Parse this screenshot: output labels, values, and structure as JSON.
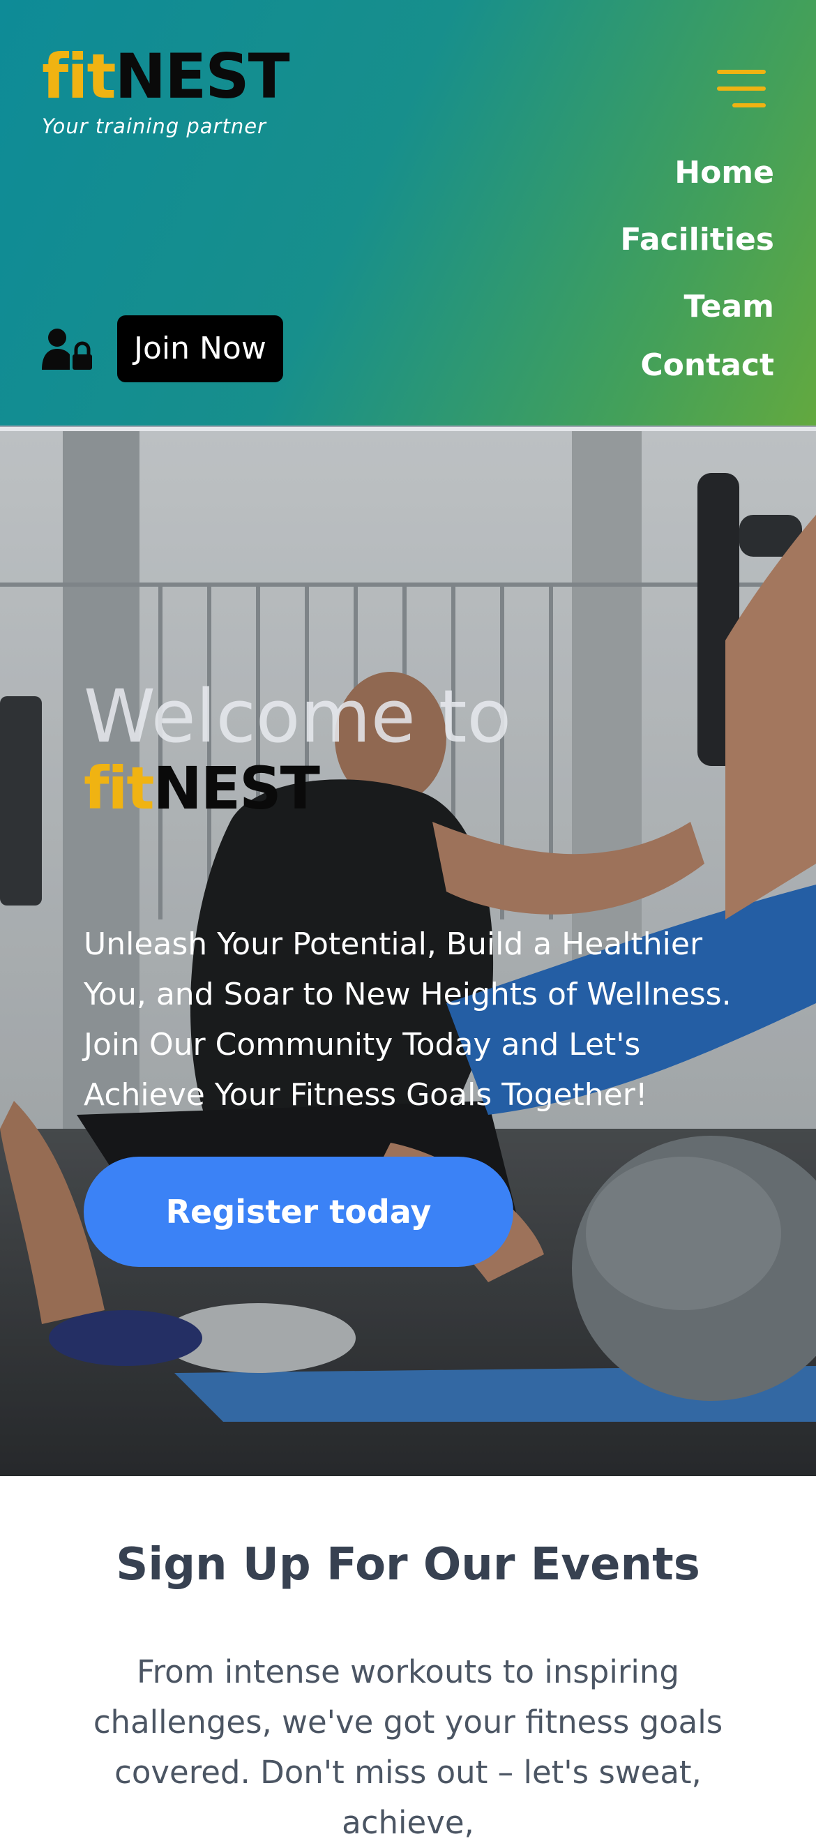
{
  "brand": {
    "fit": "fit",
    "nest": "NEST",
    "tagline": "Your training partner",
    "colors": {
      "fit": "#f0b312",
      "nest": "#0a0a0a",
      "header_start": "#0e8b97",
      "header_end": "#63a93f"
    }
  },
  "header": {
    "menu_icon": "hamburger-menu-icon",
    "account_icon": "user-lock-icon",
    "join_label": "Join Now"
  },
  "nav": {
    "items": [
      "Home",
      "Facilities",
      "Team",
      "Contact"
    ]
  },
  "hero": {
    "title": "Welcome to",
    "logo_fit": "fit",
    "logo_nest": "NEST",
    "text": "Unleash Your Potential, Build a Healthier You, and Soar to New Heights of Wellness. Join Our Community Today and Let's Achieve Your Fitness Goals Together!",
    "cta_label": "Register today",
    "cta_color": "#3b82f6"
  },
  "events": {
    "title": "Sign Up For Our Events",
    "text": "From intense workouts to inspiring challenges, we've got your fitness goals covered. Don't miss out – let's sweat, achieve,"
  }
}
